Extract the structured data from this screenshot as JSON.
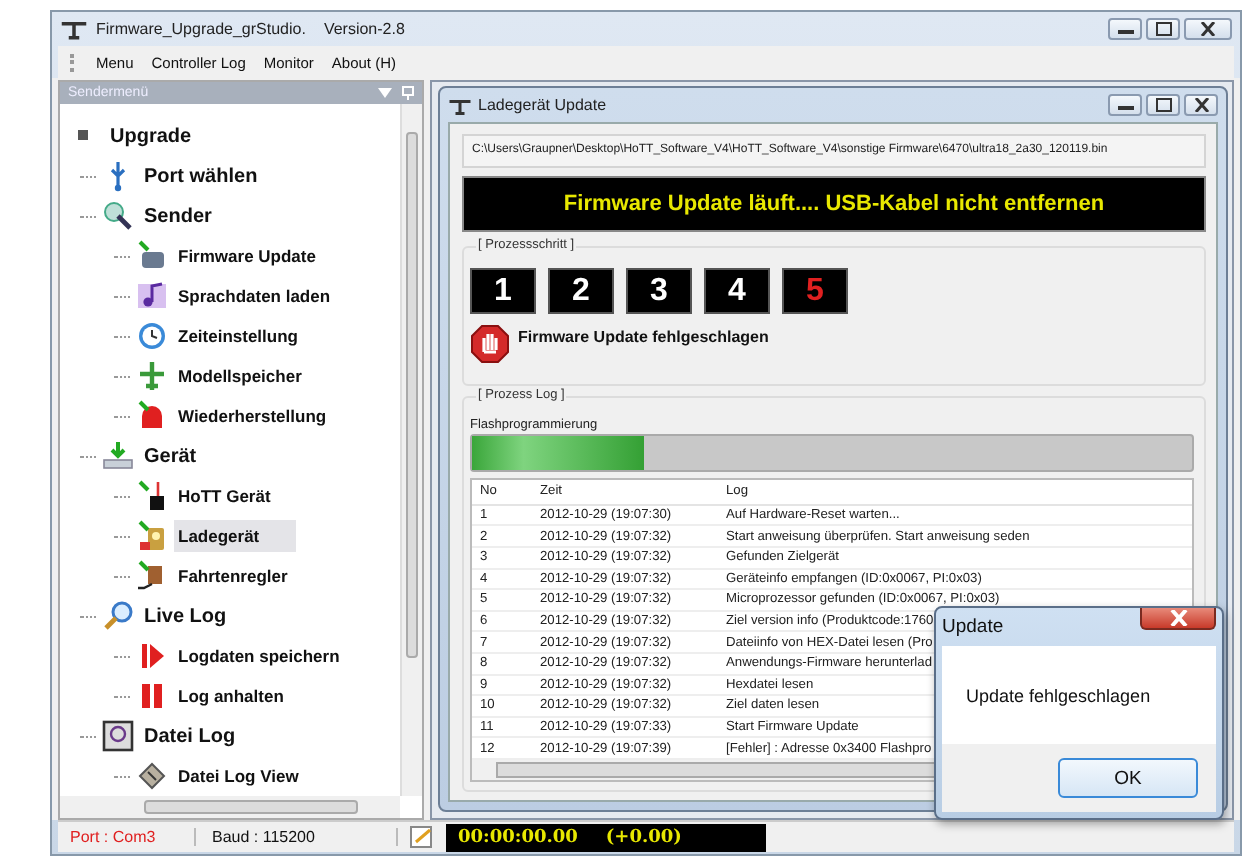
{
  "window": {
    "title": "Firmware_Upgrade_grStudio.",
    "version": "Version-2.8"
  },
  "menu": [
    "Menu",
    "Controller Log",
    "Monitor",
    "About (H)"
  ],
  "sidebar": {
    "title": "Sendermenü",
    "tree": [
      {
        "label": "Upgrade",
        "selected": false,
        "children": [
          {
            "label": "Port wählen",
            "selected": false
          },
          {
            "label": "Sender",
            "selected": false,
            "children": [
              {
                "label": "Firmware Update",
                "selected": false
              },
              {
                "label": "Sprachdaten laden",
                "selected": false
              },
              {
                "label": "Zeiteinstellung",
                "selected": false
              },
              {
                "label": "Modellspeicher",
                "selected": false
              },
              {
                "label": "Wiederherstellung",
                "selected": false
              }
            ]
          },
          {
            "label": "Gerät",
            "selected": false,
            "children": [
              {
                "label": "HoTT Gerät",
                "selected": false
              },
              {
                "label": "Ladegerät",
                "selected": true
              },
              {
                "label": "Fahrtenregler",
                "selected": false
              }
            ]
          },
          {
            "label": "Live Log",
            "selected": false,
            "children": [
              {
                "label": "Logdaten speichern",
                "selected": false
              },
              {
                "label": "Log anhalten",
                "selected": false
              }
            ]
          },
          {
            "label": "Datei Log",
            "selected": false,
            "children": [
              {
                "label": "Datei Log View",
                "selected": false
              }
            ]
          }
        ]
      }
    ]
  },
  "child_window": {
    "title": "Ladegerät Update",
    "file_path": "C:\\Users\\Graupner\\Desktop\\HoTT_Software_V4\\HoTT_Software_V4\\sonstige Firmware\\6470\\ultra18_2a30_120119.bin",
    "banner": "Firmware Update läuft.... USB-Kabel nicht entfernen",
    "process_steps": {
      "title": "[ Prozessschritt ]",
      "steps": [
        {
          "label": "1",
          "failed": false
        },
        {
          "label": "2",
          "failed": false
        },
        {
          "label": "3",
          "failed": false
        },
        {
          "label": "4",
          "failed": false
        },
        {
          "label": "5",
          "failed": true
        }
      ],
      "status": "Firmware Update fehlgeschlagen"
    },
    "process_log": {
      "title": "[ Prozess Log ]",
      "stage": "Flashprogrammierung",
      "level": 0.24,
      "columns": [
        "No",
        "Zeit",
        "Log"
      ],
      "rows": [
        [
          "1",
          "2012-10-29 (19:07:30)",
          "Auf Hardware-Reset warten..."
        ],
        [
          "2",
          "2012-10-29 (19:07:32)",
          "Start anweisung überprüfen. Start anweisung seden"
        ],
        [
          "3",
          "2012-10-29 (19:07:32)",
          "Gefunden Zielgerät"
        ],
        [
          "4",
          "2012-10-29 (19:07:32)",
          "Geräteinfo empfangen (ID:0x0067, PI:0x03)"
        ],
        [
          "5",
          "2012-10-29 (19:07:32)",
          "Microprozessor gefunden (ID:0x0067, PI:0x03)"
        ],
        [
          "6",
          "2012-10-29 (19:07:32)",
          "Ziel version info (Produktcode:1760"
        ],
        [
          "7",
          "2012-10-29 (19:07:32)",
          "Dateiinfo von HEX-Datei lesen (Pro"
        ],
        [
          "8",
          "2012-10-29 (19:07:32)",
          "Anwendungs-Firmware herunterlad"
        ],
        [
          "9",
          "2012-10-29 (19:07:32)",
          "Hexdatei lesen"
        ],
        [
          "10",
          "2012-10-29 (19:07:32)",
          "Ziel daten lesen"
        ],
        [
          "11",
          "2012-10-29 (19:07:33)",
          "Start Firmware Update"
        ],
        [
          "12",
          "2012-10-29 (19:07:39)",
          "[Fehler] : Adresse 0x3400 Flashpro"
        ]
      ]
    }
  },
  "dialog": {
    "title": "Update",
    "message": "Update fehlgeschlagen",
    "button": "OK"
  },
  "status_bar": {
    "port": "Port : Com3",
    "baud": "Baud : 115200",
    "timer": "00:00:00.00",
    "offset": "(+0.00)"
  }
}
